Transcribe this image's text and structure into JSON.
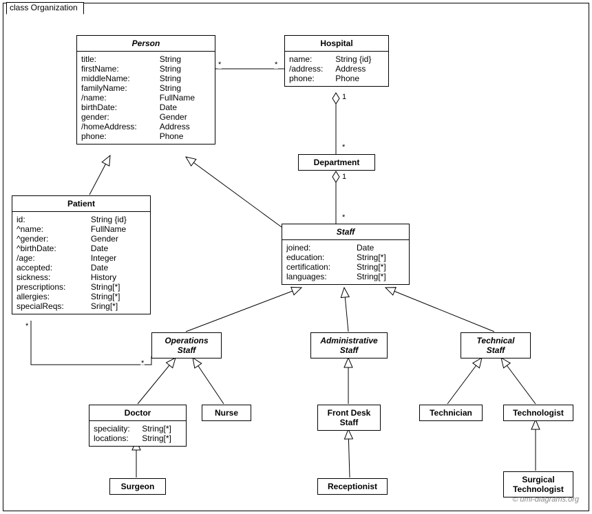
{
  "frameTitle": "class Organization",
  "copyright": "© uml-diagrams.org",
  "classes": {
    "person": {
      "title": "Person",
      "attrs": [
        [
          "title:",
          "String"
        ],
        [
          "firstName:",
          "String"
        ],
        [
          "middleName:",
          "String"
        ],
        [
          "familyName:",
          "String"
        ],
        [
          "/name:",
          "FullName"
        ],
        [
          "birthDate:",
          "Date"
        ],
        [
          "gender:",
          "Gender"
        ],
        [
          "/homeAddress:",
          "Address"
        ],
        [
          "phone:",
          "Phone"
        ]
      ]
    },
    "hospital": {
      "title": "Hospital",
      "attrs": [
        [
          "name:",
          "String {id}"
        ],
        [
          "/address:",
          "Address"
        ],
        [
          "phone:",
          "Phone"
        ]
      ]
    },
    "department": {
      "title": "Department"
    },
    "patient": {
      "title": "Patient",
      "attrs": [
        [
          "id:",
          "String {id}"
        ],
        [
          "^name:",
          "FullName"
        ],
        [
          "^gender:",
          "Gender"
        ],
        [
          "^birthDate:",
          "Date"
        ],
        [
          "/age:",
          "Integer"
        ],
        [
          "accepted:",
          "Date"
        ],
        [
          "sickness:",
          "History"
        ],
        [
          "prescriptions:",
          "String[*]"
        ],
        [
          "allergies:",
          "String[*]"
        ],
        [
          "specialReqs:",
          "Sring[*]"
        ]
      ]
    },
    "staff": {
      "title": "Staff",
      "attrs": [
        [
          "joined:",
          "Date"
        ],
        [
          "education:",
          "String[*]"
        ],
        [
          "certification:",
          "String[*]"
        ],
        [
          "languages:",
          "String[*]"
        ]
      ]
    },
    "opsStaff": {
      "title": "Operations\nStaff"
    },
    "adminStaff": {
      "title": "Administrative\nStaff"
    },
    "techStaff": {
      "title": "Technical\nStaff"
    },
    "doctor": {
      "title": "Doctor",
      "attrs": [
        [
          "speciality:",
          "String[*]"
        ],
        [
          "locations:",
          "String[*]"
        ]
      ]
    },
    "nurse": {
      "title": "Nurse"
    },
    "frontDesk": {
      "title": "Front Desk\nStaff"
    },
    "receptionist": {
      "title": "Receptionist"
    },
    "technician": {
      "title": "Technician"
    },
    "technologist": {
      "title": "Technologist"
    },
    "surgeon": {
      "title": "Surgeon"
    },
    "surgTech": {
      "title": "Surgical\nTechnologist"
    }
  },
  "multiplicities": {
    "m1": "*",
    "m2": "*",
    "m3": "1",
    "m4": "*",
    "m5": "1",
    "m6": "*",
    "m7": "*",
    "m8": "*"
  }
}
